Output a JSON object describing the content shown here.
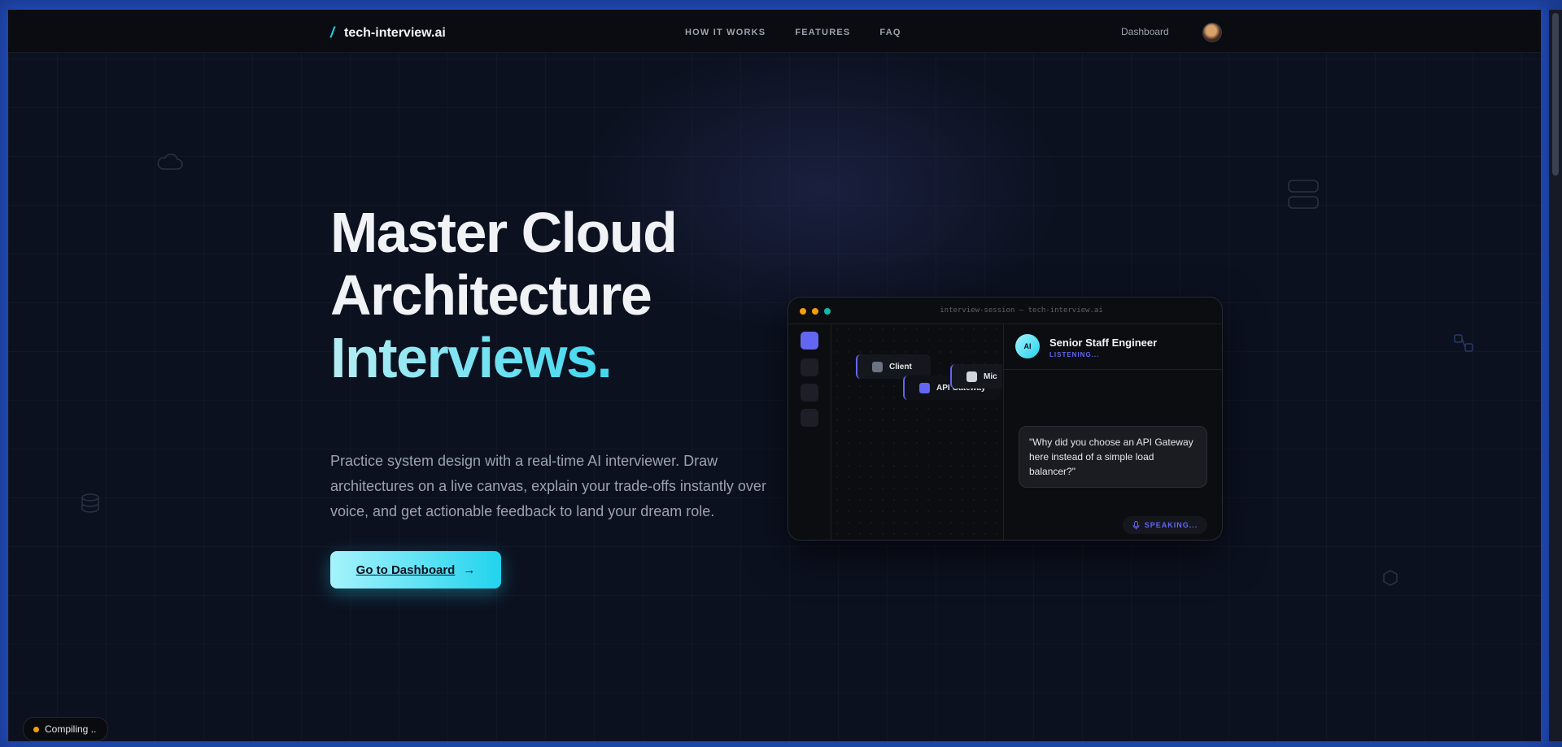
{
  "nav": {
    "brand_slash": "/",
    "brand": "tech-interview.ai",
    "links": [
      "HOW IT WORKS",
      "FEATURES",
      "FAQ"
    ],
    "dashboard": "Dashboard"
  },
  "hero": {
    "title_line1": "Master Cloud",
    "title_line2": "Architecture",
    "title_line3": "Interviews.",
    "description": "Practice system design with a real-time AI interviewer. Draw architectures on a live canvas, explain your trade-offs instantly over voice, and get actionable feedback to land your dream role.",
    "cta_label": "Go to Dashboard",
    "cta_arrow": "→"
  },
  "mock": {
    "window_title": "interview-session — tech-interview.ai",
    "nodes": [
      "Client",
      "API Gateway",
      "Mic"
    ],
    "interviewer_initials": "AI",
    "interviewer_name": "Senior Staff Engineer",
    "interviewer_status": "LISTENING...",
    "message": "\"Why did you choose an API Gateway here instead of a simple load balancer?\"",
    "speaking": "SPEAKING..."
  },
  "status": {
    "compiling": "Compiling .."
  },
  "colors": {
    "accent": "#22d3ee",
    "indigo": "#6366f1",
    "background": "#0c1120"
  }
}
